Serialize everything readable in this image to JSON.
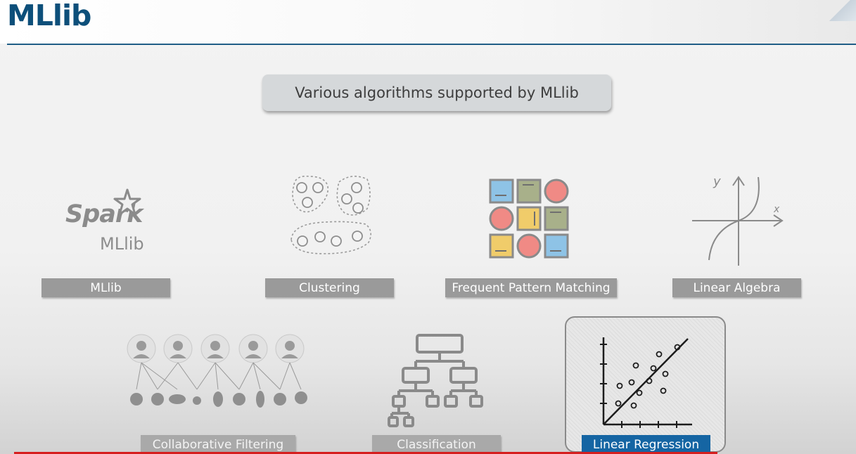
{
  "slide": {
    "title": "MLlib",
    "callout": "Various algorithms supported by MLlib"
  },
  "tiles": [
    {
      "label": "MLlib",
      "icon": "spark-mllib-logo-icon",
      "logo_text": "Spark",
      "logo_sub": "MLlib"
    },
    {
      "label": "Clustering",
      "icon": "clustering-icon"
    },
    {
      "label": "Frequent Pattern Matching",
      "icon": "pattern-grid-icon"
    },
    {
      "label": "Linear Algebra",
      "icon": "axes-graph-icon",
      "axis_y": "y",
      "axis_x": "x"
    },
    {
      "label": "Collaborative Filtering",
      "icon": "users-items-icon"
    },
    {
      "label": "Classification",
      "icon": "tree-diagram-icon"
    },
    {
      "label": "Linear Regression",
      "icon": "scatter-regression-icon",
      "selected": true
    }
  ],
  "colors": {
    "title": "#0d4f7a",
    "rule": "#1f5d86",
    "label_bg": "#9a9a9a",
    "selected_label_bg": "#1565a3",
    "pattern_blue": "#8ec3e6",
    "pattern_green": "#a8b08a",
    "pattern_red": "#f08a85",
    "pattern_yellow": "#f0cc6a"
  }
}
